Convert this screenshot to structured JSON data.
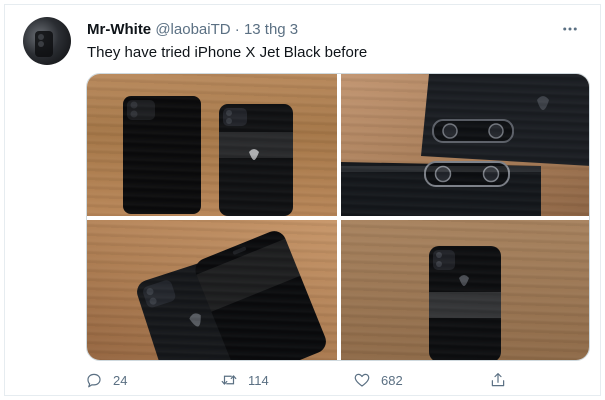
{
  "tweet": {
    "author_name": "Mr-White",
    "handle": "@laobaiTD",
    "separator": "·",
    "date": "13 thg 3",
    "text": "They have tried iPhone X Jet Black before",
    "more_icon": "more-horizontal-icon"
  },
  "media": {
    "photos": [
      {
        "subject": "two black iPhones on wooden table"
      },
      {
        "subject": "close-up of dual camera module"
      },
      {
        "subject": "two iPhones angled on wood"
      },
      {
        "subject": "single iPhone standing on wood"
      }
    ]
  },
  "actions": {
    "reply_count": "24",
    "retweet_count": "114",
    "like_count": "682",
    "reply_icon": "reply-icon",
    "retweet_icon": "retweet-icon",
    "like_icon": "heart-icon",
    "share_icon": "share-icon"
  },
  "colors": {
    "text": "#0f1419",
    "secondary": "#5b7083",
    "border": "#cfd9de"
  }
}
